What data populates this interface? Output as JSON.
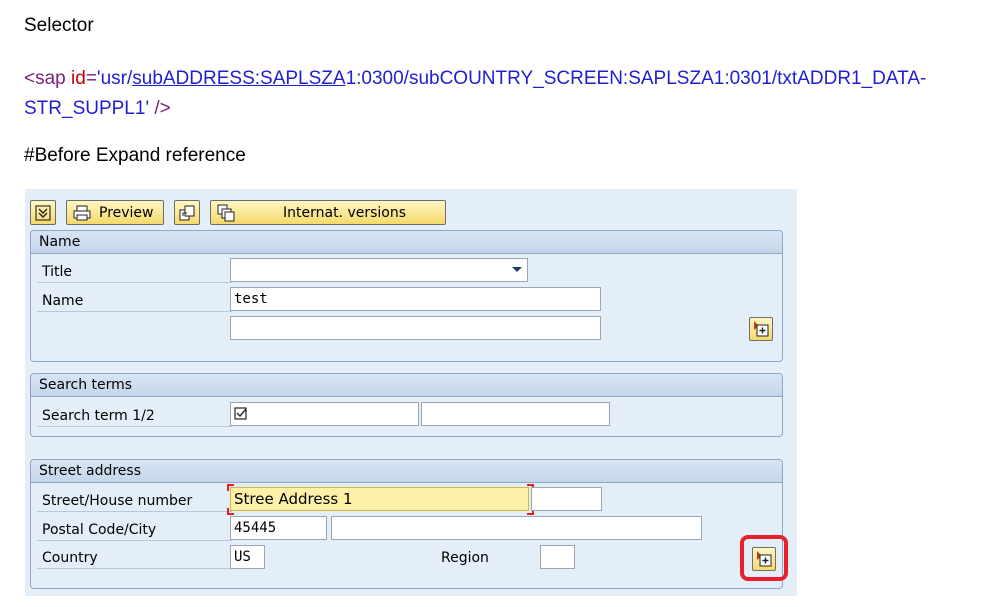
{
  "doc": {
    "heading": "Selector",
    "code": {
      "tag_open": "<sap",
      "attr": "id",
      "eq": "=",
      "q1": "'",
      "usr": "usr/",
      "sub_link": "subADDRESS:SAPLSZA",
      "rest": "1:0300/subCOUNTRY_SCREEN:SAPLSZA1:0301/txtADDR1_DATA-STR_SUPPL1",
      "q2": "'",
      "tag_close": " />"
    },
    "note": "#Before Expand reference"
  },
  "toolbar": {
    "preview_label": "Preview",
    "internat_label": "Internat. versions"
  },
  "name_group": {
    "title": "Name",
    "title_label": "Title",
    "title_value": "",
    "name_label": "Name",
    "name_value": "test",
    "name2_value": ""
  },
  "search_group": {
    "title": "Search terms",
    "term_label": "Search term 1/2",
    "term2_value": ""
  },
  "street_group": {
    "title": "Street address",
    "street_label": "Street/House number",
    "street_value": "Stree Address 1",
    "house_value": "",
    "postal_label": "Postal Code/City",
    "postal_value": "45445",
    "city_value": "",
    "country_label": "Country",
    "country_value": "US",
    "region_label": "Region",
    "region_value": ""
  },
  "colors": {
    "highlight": "#e8202e",
    "code_tag": "#7a1f7a",
    "code_attr": "#c00000",
    "code_value": "#1f1fd0"
  }
}
